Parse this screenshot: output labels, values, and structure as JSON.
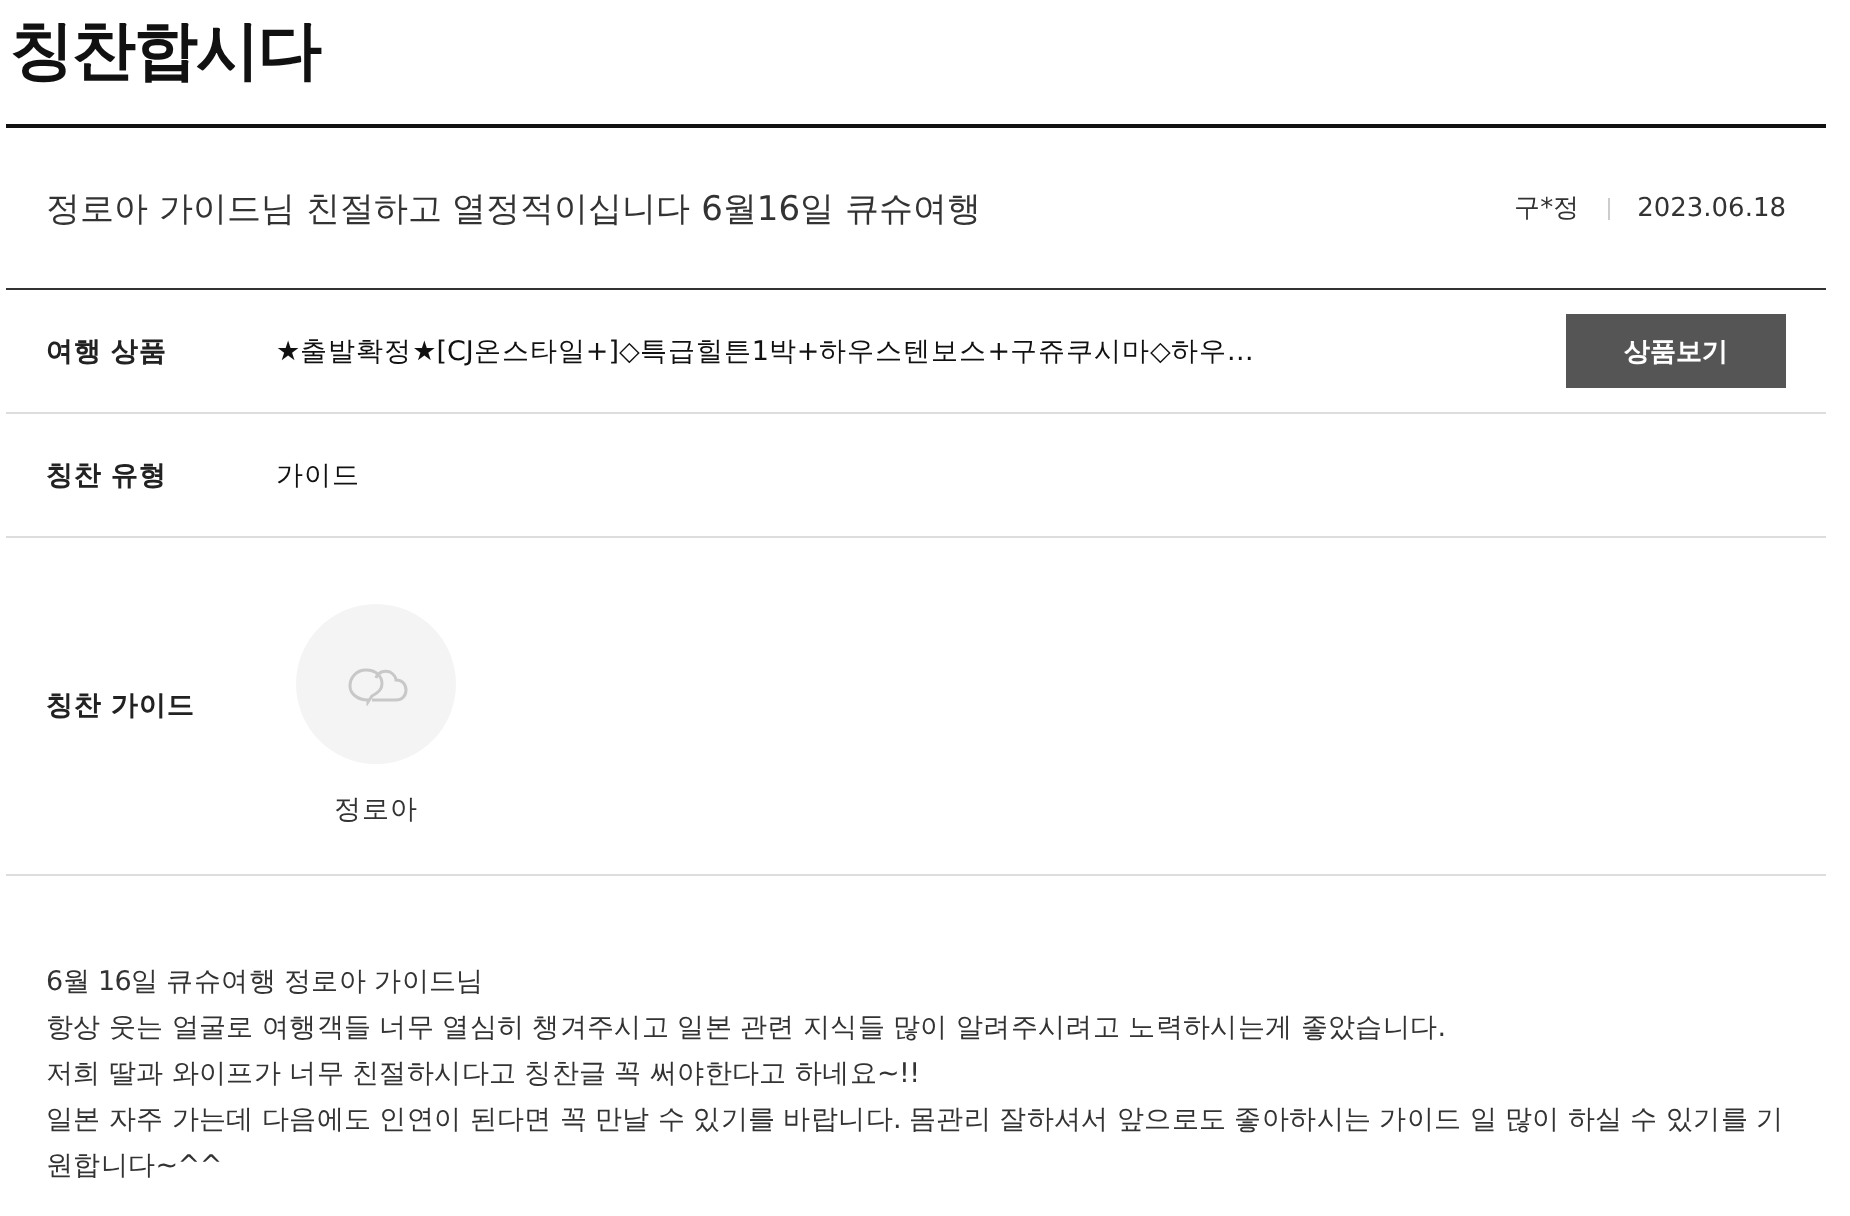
{
  "page_title": "칭찬합시다",
  "post": {
    "title": "정로아 가이드님 친절하고 열정적이십니다 6월16일 큐슈여행",
    "author": "구*정",
    "date": "2023.06.18"
  },
  "fields": [
    {
      "kind": "product",
      "label": "여행 상품",
      "value": "★출발확정★[CJ온스타일+]◇특급힐튼1박+하우스텐보스+구쥬쿠시마◇하우…",
      "button": "상품보기"
    },
    {
      "kind": "text",
      "label": "칭찬 유형",
      "value": "가이드"
    },
    {
      "kind": "guide",
      "label": "칭찬 가이드",
      "name": "정로아"
    }
  ],
  "body": [
    "6월 16일 큐슈여행 정로아 가이드님",
    "항상 웃는 얼굴로 여행객들 너무 열심히 챙겨주시고 일본 관련 지식들 많이 알려주시려고 노력하시는게 좋았습니다.",
    "저희 딸과 와이프가 너무 친절하시다고 칭찬글 꼭 써야한다고 하네요~!!",
    "일본 자주 가는데 다음에도 인연이 된다면 꼭 만날 수 있기를 바랍니다. 몸관리 잘하셔서 앞으로도 좋아하시는 가이드 일 많이 하실 수 있기를 기원합니다~^^"
  ]
}
